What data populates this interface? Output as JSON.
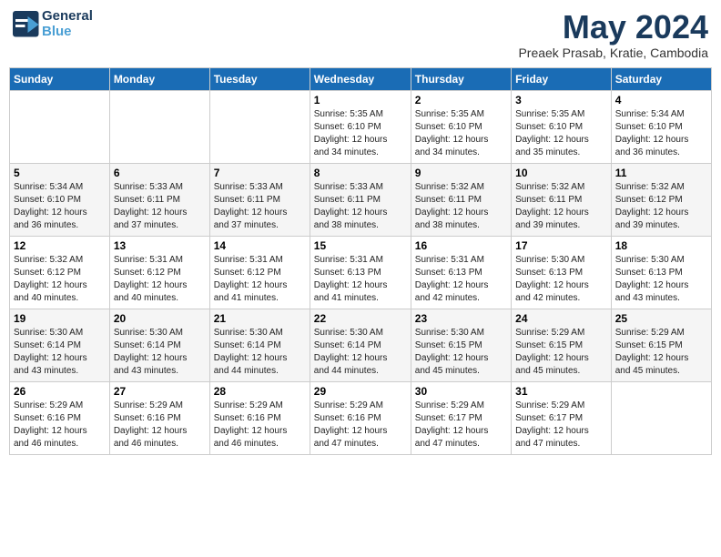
{
  "header": {
    "logo_line1": "General",
    "logo_line2": "Blue",
    "month_title": "May 2024",
    "location": "Preaek Prasab, Kratie, Cambodia"
  },
  "weekdays": [
    "Sunday",
    "Monday",
    "Tuesday",
    "Wednesday",
    "Thursday",
    "Friday",
    "Saturday"
  ],
  "weeks": [
    [
      {
        "day": "",
        "info": ""
      },
      {
        "day": "",
        "info": ""
      },
      {
        "day": "",
        "info": ""
      },
      {
        "day": "1",
        "info": "Sunrise: 5:35 AM\nSunset: 6:10 PM\nDaylight: 12 hours\nand 34 minutes."
      },
      {
        "day": "2",
        "info": "Sunrise: 5:35 AM\nSunset: 6:10 PM\nDaylight: 12 hours\nand 34 minutes."
      },
      {
        "day": "3",
        "info": "Sunrise: 5:35 AM\nSunset: 6:10 PM\nDaylight: 12 hours\nand 35 minutes."
      },
      {
        "day": "4",
        "info": "Sunrise: 5:34 AM\nSunset: 6:10 PM\nDaylight: 12 hours\nand 36 minutes."
      }
    ],
    [
      {
        "day": "5",
        "info": "Sunrise: 5:34 AM\nSunset: 6:10 PM\nDaylight: 12 hours\nand 36 minutes."
      },
      {
        "day": "6",
        "info": "Sunrise: 5:33 AM\nSunset: 6:11 PM\nDaylight: 12 hours\nand 37 minutes."
      },
      {
        "day": "7",
        "info": "Sunrise: 5:33 AM\nSunset: 6:11 PM\nDaylight: 12 hours\nand 37 minutes."
      },
      {
        "day": "8",
        "info": "Sunrise: 5:33 AM\nSunset: 6:11 PM\nDaylight: 12 hours\nand 38 minutes."
      },
      {
        "day": "9",
        "info": "Sunrise: 5:32 AM\nSunset: 6:11 PM\nDaylight: 12 hours\nand 38 minutes."
      },
      {
        "day": "10",
        "info": "Sunrise: 5:32 AM\nSunset: 6:11 PM\nDaylight: 12 hours\nand 39 minutes."
      },
      {
        "day": "11",
        "info": "Sunrise: 5:32 AM\nSunset: 6:12 PM\nDaylight: 12 hours\nand 39 minutes."
      }
    ],
    [
      {
        "day": "12",
        "info": "Sunrise: 5:32 AM\nSunset: 6:12 PM\nDaylight: 12 hours\nand 40 minutes."
      },
      {
        "day": "13",
        "info": "Sunrise: 5:31 AM\nSunset: 6:12 PM\nDaylight: 12 hours\nand 40 minutes."
      },
      {
        "day": "14",
        "info": "Sunrise: 5:31 AM\nSunset: 6:12 PM\nDaylight: 12 hours\nand 41 minutes."
      },
      {
        "day": "15",
        "info": "Sunrise: 5:31 AM\nSunset: 6:13 PM\nDaylight: 12 hours\nand 41 minutes."
      },
      {
        "day": "16",
        "info": "Sunrise: 5:31 AM\nSunset: 6:13 PM\nDaylight: 12 hours\nand 42 minutes."
      },
      {
        "day": "17",
        "info": "Sunrise: 5:30 AM\nSunset: 6:13 PM\nDaylight: 12 hours\nand 42 minutes."
      },
      {
        "day": "18",
        "info": "Sunrise: 5:30 AM\nSunset: 6:13 PM\nDaylight: 12 hours\nand 43 minutes."
      }
    ],
    [
      {
        "day": "19",
        "info": "Sunrise: 5:30 AM\nSunset: 6:14 PM\nDaylight: 12 hours\nand 43 minutes."
      },
      {
        "day": "20",
        "info": "Sunrise: 5:30 AM\nSunset: 6:14 PM\nDaylight: 12 hours\nand 43 minutes."
      },
      {
        "day": "21",
        "info": "Sunrise: 5:30 AM\nSunset: 6:14 PM\nDaylight: 12 hours\nand 44 minutes."
      },
      {
        "day": "22",
        "info": "Sunrise: 5:30 AM\nSunset: 6:14 PM\nDaylight: 12 hours\nand 44 minutes."
      },
      {
        "day": "23",
        "info": "Sunrise: 5:30 AM\nSunset: 6:15 PM\nDaylight: 12 hours\nand 45 minutes."
      },
      {
        "day": "24",
        "info": "Sunrise: 5:29 AM\nSunset: 6:15 PM\nDaylight: 12 hours\nand 45 minutes."
      },
      {
        "day": "25",
        "info": "Sunrise: 5:29 AM\nSunset: 6:15 PM\nDaylight: 12 hours\nand 45 minutes."
      }
    ],
    [
      {
        "day": "26",
        "info": "Sunrise: 5:29 AM\nSunset: 6:16 PM\nDaylight: 12 hours\nand 46 minutes."
      },
      {
        "day": "27",
        "info": "Sunrise: 5:29 AM\nSunset: 6:16 PM\nDaylight: 12 hours\nand 46 minutes."
      },
      {
        "day": "28",
        "info": "Sunrise: 5:29 AM\nSunset: 6:16 PM\nDaylight: 12 hours\nand 46 minutes."
      },
      {
        "day": "29",
        "info": "Sunrise: 5:29 AM\nSunset: 6:16 PM\nDaylight: 12 hours\nand 47 minutes."
      },
      {
        "day": "30",
        "info": "Sunrise: 5:29 AM\nSunset: 6:17 PM\nDaylight: 12 hours\nand 47 minutes."
      },
      {
        "day": "31",
        "info": "Sunrise: 5:29 AM\nSunset: 6:17 PM\nDaylight: 12 hours\nand 47 minutes."
      },
      {
        "day": "",
        "info": ""
      }
    ]
  ]
}
